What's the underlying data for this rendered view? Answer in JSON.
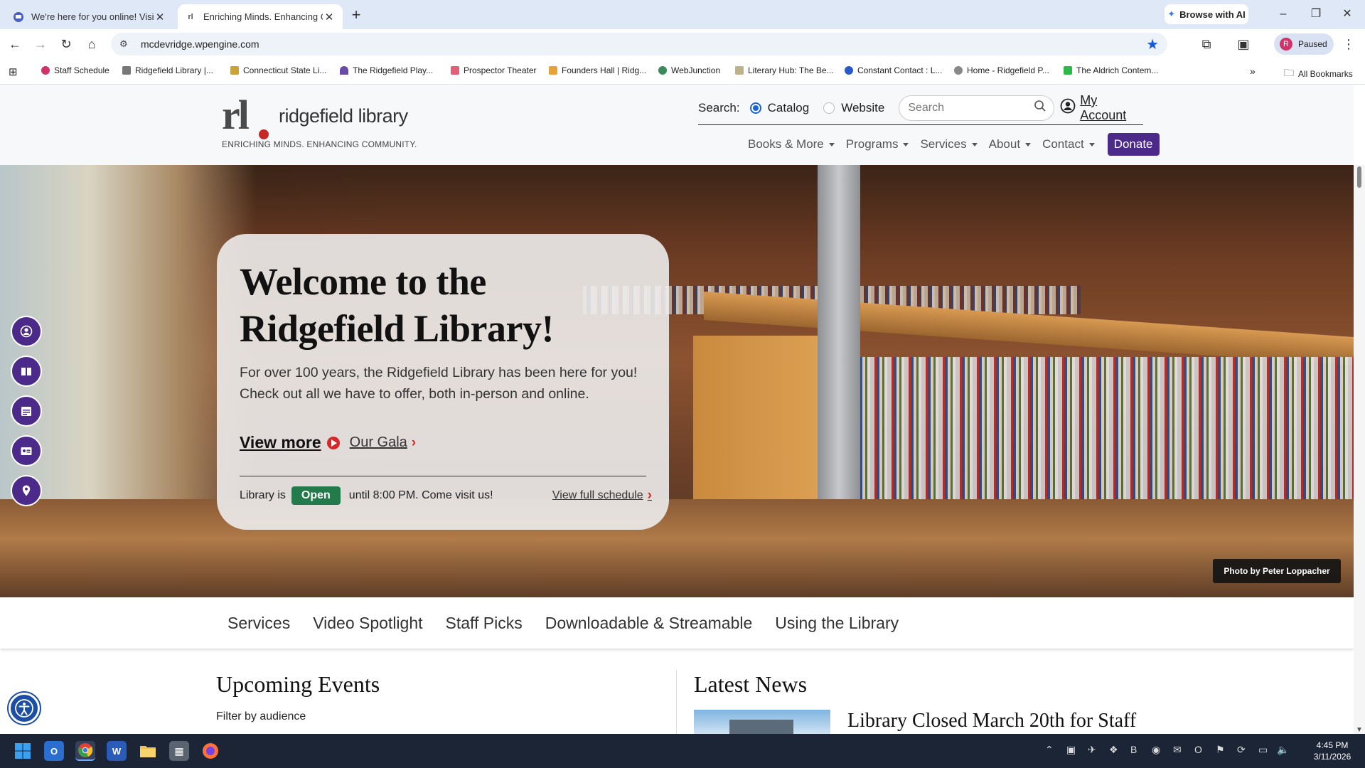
{
  "browser": {
    "tabs": [
      {
        "title": "We're here for you online! Visit",
        "active": false
      },
      {
        "title": "Enriching Minds. Enhancing Co",
        "active": true
      }
    ],
    "browse_ai_label": "Browse with AI",
    "url": "mcdevridge.wpengine.com",
    "profile_initial": "R",
    "profile_status": "Paused",
    "bookmarks": [
      "Staff Schedule",
      "Ridgefield Library |...",
      "Connecticut State Li...",
      "The Ridgefield Play...",
      "Prospector Theater",
      "Founders Hall | Ridg...",
      "WebJunction",
      "Literary Hub: The Be...",
      "Constant Contact : L...",
      "Home - Ridgefield P...",
      "The Aldrich Contem..."
    ],
    "all_bookmarks": "All Bookmarks"
  },
  "site": {
    "logo_mark": "rl",
    "logo_name": "ridgefield library",
    "tagline": "ENRICHING MINDS. ENHANCING COMMUNITY.",
    "search": {
      "label": "Search:",
      "options": [
        "Catalog",
        "Website"
      ],
      "selected": "Catalog",
      "placeholder": "Search"
    },
    "my_account": "My Account",
    "nav": [
      "Books & More",
      "Programs",
      "Services",
      "About",
      "Contact"
    ],
    "donate": "Donate",
    "brand_color": "#4b2a8a"
  },
  "hero": {
    "title": "Welcome to the Ridgefield Library!",
    "intro": "For over 100 years, the Ridgefield Library has been here for you! Check out all we have to offer, both in-person and online.",
    "view_more": "View more",
    "gala": "Our Gala",
    "status_prefix": "Library is",
    "status_badge": "Open",
    "status_suffix": "until 8:00 PM. Come visit us!",
    "full_schedule": "View full schedule",
    "photo_credit": "Photo by Peter Loppacher",
    "open_color": "#237a4b"
  },
  "side_rail": [
    "account-icon",
    "book-icon",
    "calendar-icon",
    "card-icon",
    "location-icon"
  ],
  "section_tabs": [
    "Services",
    "Video Spotlight",
    "Staff Picks",
    "Downloadable & Streamable",
    "Using the Library"
  ],
  "events": {
    "title": "Upcoming Events",
    "filter_label": "Filter by audience"
  },
  "news": {
    "title": "Latest News",
    "headline": "Library Closed March 20th for Staff"
  },
  "taskbar": {
    "time": "4:45 PM",
    "date": "3/11/2026"
  }
}
